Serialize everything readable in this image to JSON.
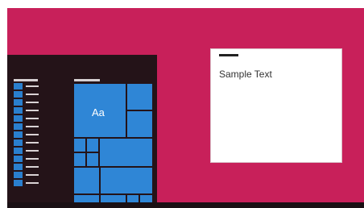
{
  "theme": {
    "accent": "#c8205a",
    "start_background": "#241318",
    "tile_color": "#2f86d6",
    "taskbar": "#1a1014"
  },
  "tiles": {
    "main_tile_label": "Aa"
  },
  "dialog": {
    "sample_text": "Sample Text"
  },
  "icons": {
    "app_icon": "app-icon"
  }
}
